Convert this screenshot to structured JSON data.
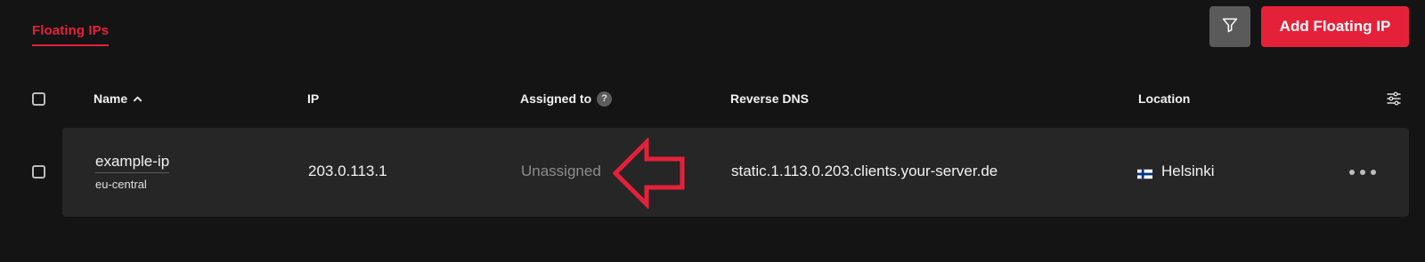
{
  "tabs": [
    {
      "label": "Floating IPs",
      "active": true
    }
  ],
  "toolbar": {
    "filter_icon": "filter-icon",
    "add_label": "Add Floating IP"
  },
  "table": {
    "columns": {
      "name": "Name",
      "ip": "IP",
      "assigned": "Assigned to",
      "assigned_help": "?",
      "rdns": "Reverse DNS",
      "location": "Location"
    },
    "sort_icon": "chevron-up-icon",
    "settings_icon": "column-settings-icon",
    "rows": [
      {
        "name": "example-ip",
        "region": "eu-central",
        "ip": "203.0.113.1",
        "assigned": "Unassigned",
        "rdns": "static.1.113.0.203.clients.your-server.de",
        "location": "Helsinki",
        "location_flag": "finland-flag-icon",
        "more_icon": "more-dots-icon"
      }
    ]
  },
  "annotation": {
    "icon": "arrow-left-annotation-icon",
    "color": "#e5213a"
  },
  "colors": {
    "accent": "#e5213a",
    "background": "#141414",
    "row_background": "#262626",
    "filter_button": "#5a5a5a"
  }
}
